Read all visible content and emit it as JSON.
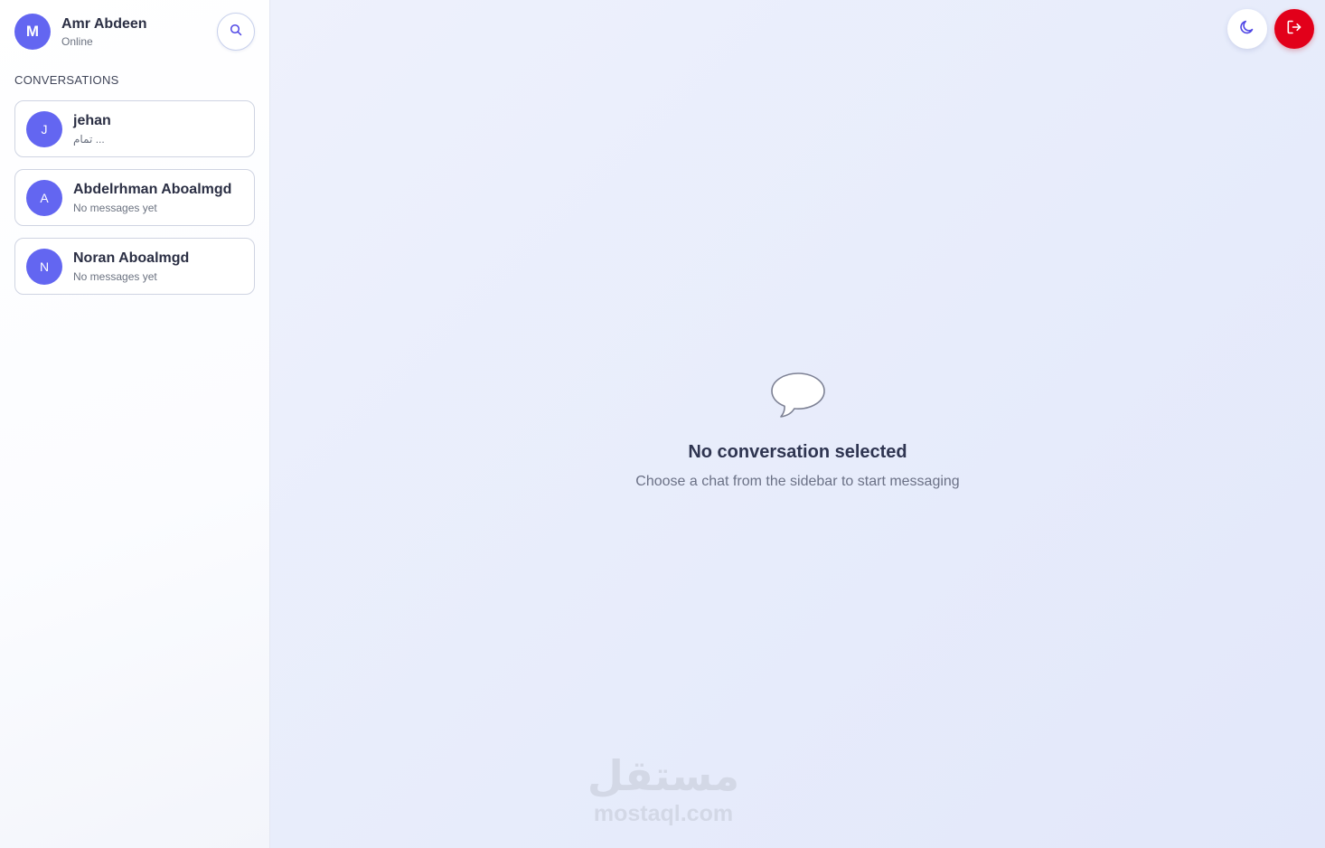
{
  "user": {
    "initial": "M",
    "name": "Amr Abdeen",
    "status": "Online"
  },
  "sidebar": {
    "section_title": "CONVERSATIONS",
    "conversations": [
      {
        "initial": "J",
        "name": "jehan",
        "preview": "تمام ..."
      },
      {
        "initial": "A",
        "name": "Abdelrhman Aboalmgd",
        "preview": "No messages yet"
      },
      {
        "initial": "N",
        "name": "Noran Aboalmgd",
        "preview": "No messages yet"
      }
    ]
  },
  "main": {
    "empty_title": "No conversation selected",
    "empty_subtitle": "Choose a chat from the sidebar to start messaging"
  },
  "watermark": {
    "logo_text": "مستقل",
    "url": "mostaql.com"
  },
  "icons": {
    "search": "search-icon",
    "theme": "moon-icon",
    "logout": "logout-icon",
    "empty_state": "chat-bubble-icon"
  },
  "colors": {
    "accent": "#6366f1",
    "logout": "#e2001a"
  }
}
